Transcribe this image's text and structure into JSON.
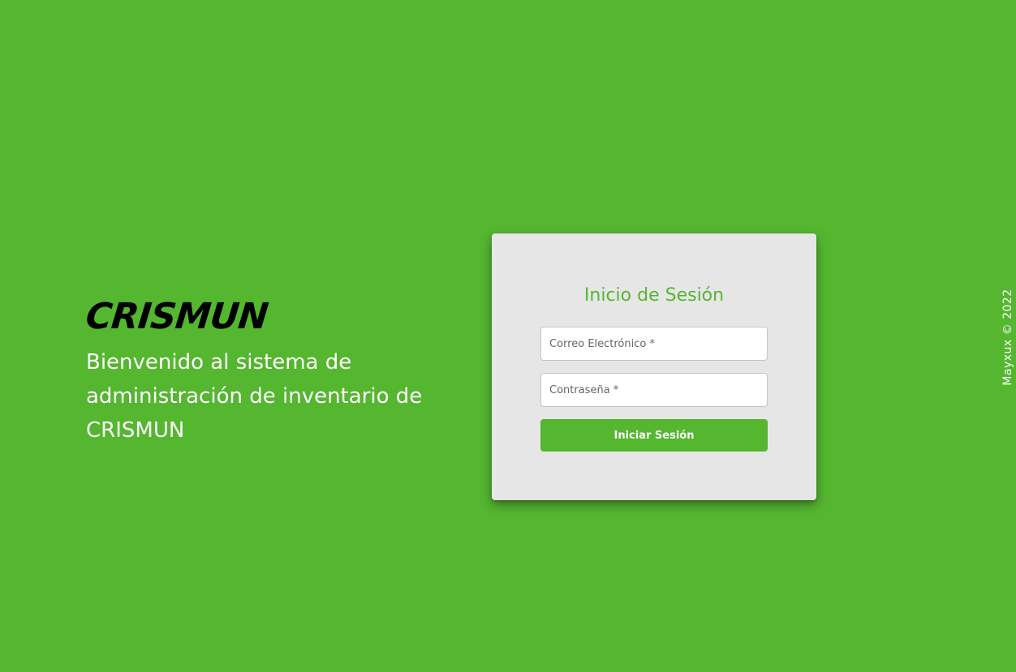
{
  "brand": {
    "logo_text": "CRISMUN",
    "welcome_text": "Bienvenido al sistema de administración de inventario de CRISMUN"
  },
  "login": {
    "title": "Inicio de Sesión",
    "email_placeholder": "Correo Electrónico *",
    "password_placeholder": "Contraseña *",
    "submit_label": "Iniciar Sesión"
  },
  "footer": {
    "credit": "Mayxux  ©  2022"
  },
  "colors": {
    "background": "#55b630",
    "card": "#e6e6e6",
    "accent": "#55b630",
    "logo": "#000000",
    "text_light": "#ffffff"
  }
}
